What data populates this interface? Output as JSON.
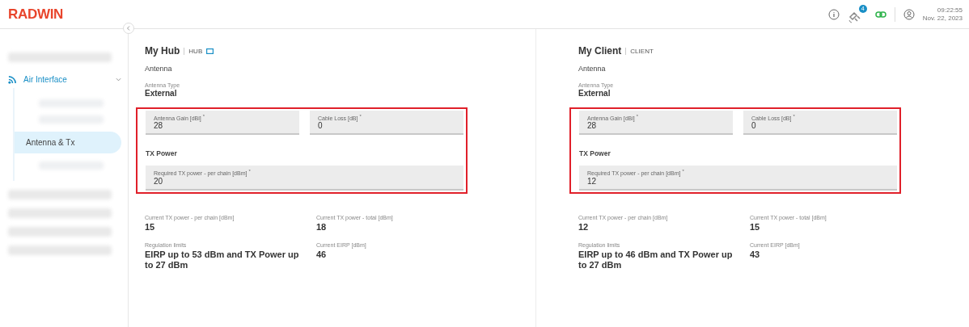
{
  "header": {
    "logo": "RADWIN",
    "badge": "4",
    "time": "09:22:55",
    "date": "Nov. 22, 2023"
  },
  "sidebar": {
    "items": [
      {
        "kind": "blurred"
      },
      {
        "kind": "group",
        "label": "Air Interface",
        "expanded": true,
        "children": [
          {
            "kind": "blurred",
            "selected": false
          },
          {
            "kind": "blurred",
            "selected": false
          },
          {
            "kind": "item",
            "label": "Antenna & Tx",
            "selected": true
          },
          {
            "kind": "blurred",
            "selected": false
          }
        ]
      },
      {
        "kind": "blurred"
      },
      {
        "kind": "blurred"
      },
      {
        "kind": "blurred"
      },
      {
        "kind": "blurred"
      }
    ]
  },
  "panels": [
    {
      "title": "My Hub",
      "role": "HUB",
      "linked": true,
      "highlighted": true,
      "section": "Antenna",
      "antenna_type_label": "Antenna Type",
      "antenna_type_value": "External",
      "fields": [
        {
          "label": "Antenna Gain [dBi]",
          "mark": "*",
          "value": "28"
        },
        {
          "label": "Cable Loss [dB]",
          "mark": "*",
          "value": "0"
        }
      ],
      "tx_heading": "TX Power",
      "tx_field": {
        "label": "Required TX power - per chain [dBm]",
        "mark": "*",
        "value": "20"
      },
      "readings": [
        {
          "label": "Current TX power - per chain [dBm]",
          "value": "15"
        },
        {
          "label": "Current TX power - total [dBm]",
          "value": "18"
        },
        {
          "label": "Regulation limits",
          "value": " EIRP up to 53 dBm and TX Power up to 27 dBm"
        },
        {
          "label": "Current EIRP [dBm]",
          "value": "46"
        }
      ]
    },
    {
      "title": "My Client",
      "role": "CLIENT",
      "linked": false,
      "highlighted": true,
      "section": "Antenna",
      "antenna_type_label": "Antenna Type",
      "antenna_type_value": "External",
      "fields": [
        {
          "label": "Antenna Gain [dBi]",
          "mark": "*",
          "value": "28"
        },
        {
          "label": "Cable Loss [dB]",
          "mark": "*",
          "value": "0"
        }
      ],
      "tx_heading": "TX Power",
      "tx_field": {
        "label": "Required TX power - per chain [dBm]",
        "mark": "*",
        "value": "12"
      },
      "readings": [
        {
          "label": "Current TX power - per chain [dBm]",
          "value": "12"
        },
        {
          "label": "Current TX power - total [dBm]",
          "value": "15"
        },
        {
          "label": "Regulation limits",
          "value": " EIRP up to 46 dBm and TX Power up to 27 dBm"
        },
        {
          "label": "Current EIRP [dBm]",
          "value": "43"
        }
      ]
    }
  ]
}
